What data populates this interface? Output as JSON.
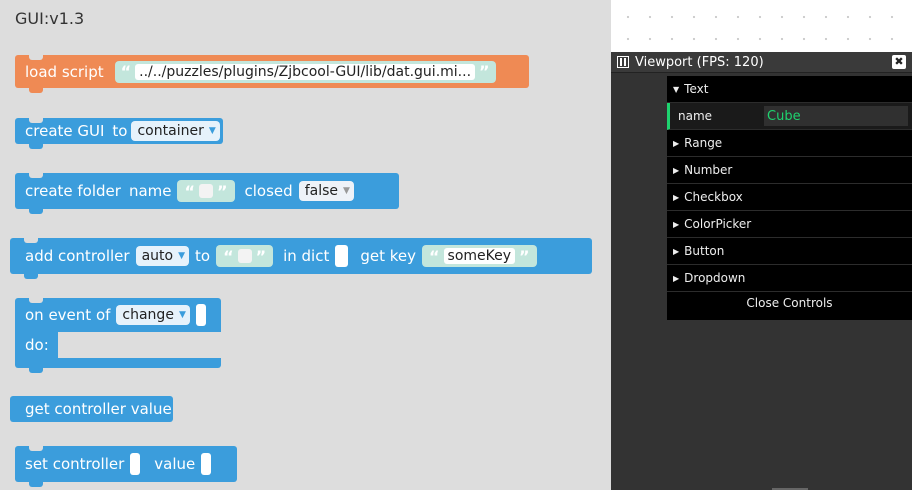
{
  "workspace": {
    "title": "GUI:v1.3",
    "load_script": {
      "label": "load script",
      "path": "../../puzzles/plugins/Zjbcool-GUI/lib/dat.gui.mi..."
    },
    "create_gui": {
      "label": "create GUI",
      "to": "to",
      "target": "container"
    },
    "create_folder": {
      "label": "create folder",
      "name": "name",
      "closed": "closed",
      "closed_value": "false"
    },
    "add_controller": {
      "label": "add controller",
      "type": "auto",
      "to": "to",
      "in_dict": "in dict",
      "get_key": "get key",
      "key": "someKey"
    },
    "on_event": {
      "label": "on event of",
      "event": "change",
      "do": "do:"
    },
    "get_value": {
      "label": "get controller value"
    },
    "set_controller": {
      "label": "set controller",
      "value": "value"
    },
    "quote_open": "“",
    "quote_close": "”"
  },
  "viewport": {
    "title": "Viewport (FPS: 120)",
    "close_icon": "✖"
  },
  "gui": {
    "folders": [
      {
        "label": "Text",
        "open": true
      },
      {
        "label": "Range",
        "open": false
      },
      {
        "label": "Number",
        "open": false
      },
      {
        "label": "Checkbox",
        "open": false
      },
      {
        "label": "ColorPicker",
        "open": false
      },
      {
        "label": "Button",
        "open": false
      },
      {
        "label": "Dropdown",
        "open": false
      }
    ],
    "text_controller": {
      "name": "name",
      "value": "Cube"
    },
    "close_label": "Close Controls",
    "tri_open": "▼",
    "tri_closed": "▶"
  },
  "colors": {
    "block_blue": "#3b9ddc",
    "block_orange": "#ef8a54",
    "string_bg": "#c3e6dc",
    "gui_text_green": "#1ed36f"
  }
}
